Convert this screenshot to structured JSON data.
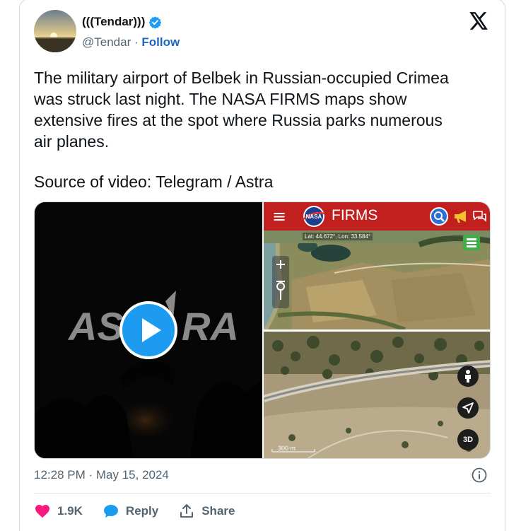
{
  "author": {
    "display_name": "(((Tendar)))",
    "handle": "@Tendar",
    "separator": "·",
    "follow_label": "Follow"
  },
  "tweet": {
    "text": "The military airport of Belbek in Russian-occupied Crimea\nwas struck last night. The NASA FIRMS maps show\nextensive fires at the spot where Russia parks numerous\nair planes.",
    "source": "Source of video: Telegram / Astra"
  },
  "media": {
    "video_watermark_left": "AS",
    "video_watermark_right": "RA",
    "firms_title": "FIRMS",
    "nasa_label": "NASA",
    "menu_icon": "≡",
    "coords": "Lat: 44.672°, Lon: 33.584°",
    "scale_label": "300 m",
    "btn_3d": "3D"
  },
  "meta": {
    "timestamp": "12:28 PM · May 15, 2024"
  },
  "actions": {
    "likes": "1.9K",
    "reply_label": "Reply",
    "share_label": "Share"
  },
  "colors": {
    "follow_blue": "#1d66c4",
    "heart_pink": "#f91880",
    "reply_blue": "#1d9bf0",
    "firms_red": "#c21f1f"
  }
}
